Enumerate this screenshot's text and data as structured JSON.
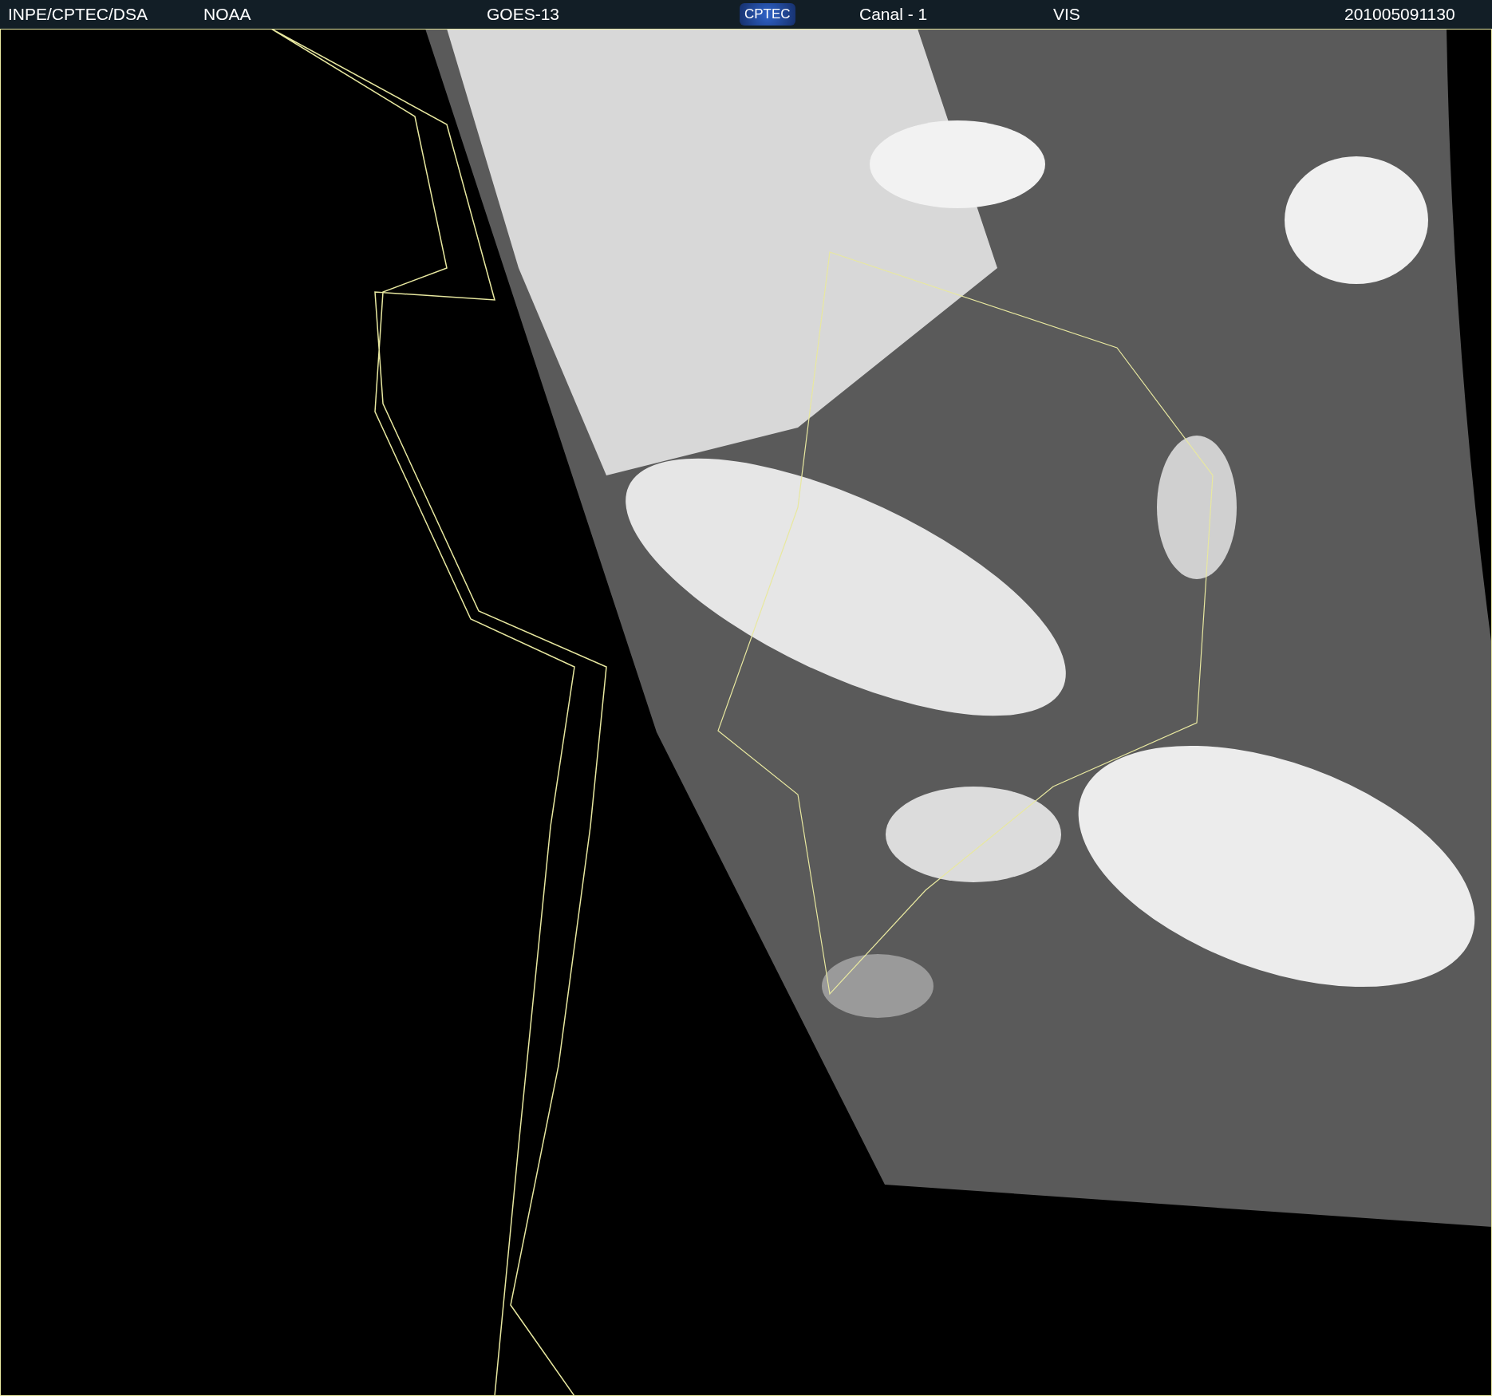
{
  "header": {
    "items": [
      {
        "kind": "text",
        "text": "INPE/CPTEC/DSA"
      },
      {
        "kind": "text",
        "text": "NOAA"
      },
      {
        "kind": "text",
        "text": "GOES-13"
      },
      {
        "kind": "logo",
        "text": "CPTEC"
      },
      {
        "kind": "text",
        "text": "Canal - 1"
      },
      {
        "kind": "text",
        "text": "VIS"
      },
      {
        "kind": "text",
        "text": "201005091130"
      }
    ]
  }
}
